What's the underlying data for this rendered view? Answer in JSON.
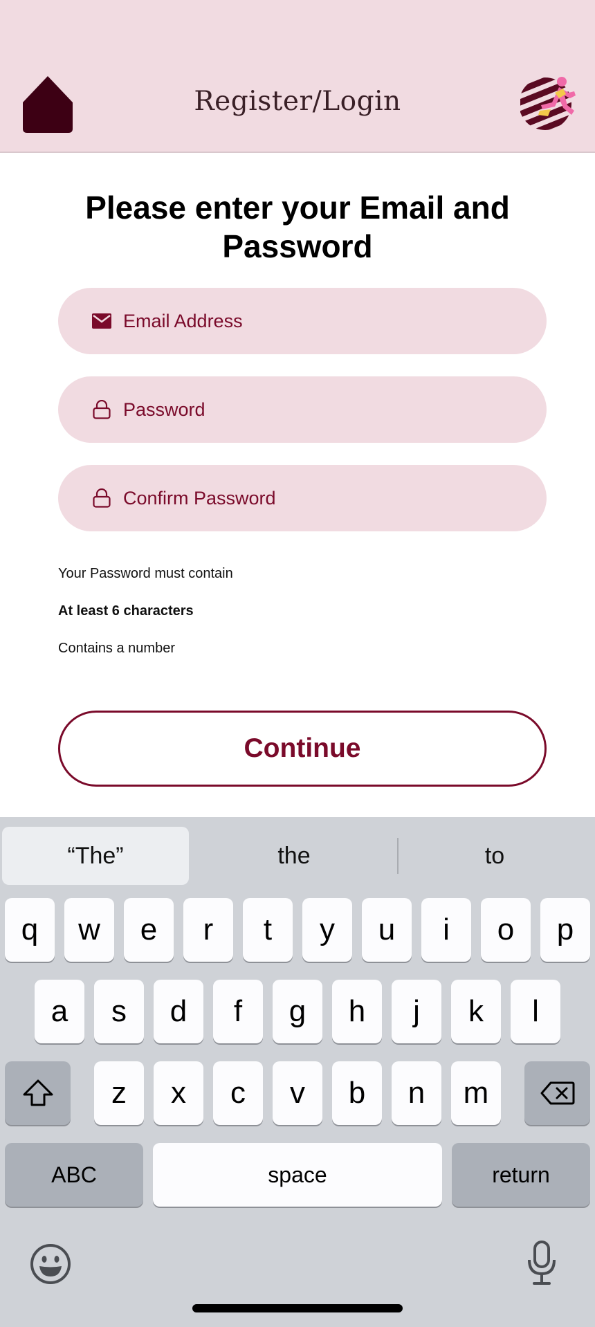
{
  "header": {
    "title": "Register/Login",
    "home_icon": "home-icon",
    "logo_icon": "runner-logo"
  },
  "main": {
    "heading": "Please enter your Email and Password",
    "email": {
      "placeholder": "Email Address",
      "value": "",
      "icon": "mail-icon"
    },
    "password": {
      "placeholder": "Password",
      "value": "",
      "icon": "lock-icon"
    },
    "confirm": {
      "placeholder": "Confirm Password",
      "value": "",
      "icon": "lock-icon"
    },
    "rules": {
      "intro": "Your Password must contain",
      "rule1": "At least 6 characters",
      "rule2": "Contains a number"
    },
    "continue_label": "Continue"
  },
  "keyboard": {
    "suggestions": [
      "“The”",
      "the",
      "to"
    ],
    "row1": [
      "q",
      "w",
      "e",
      "r",
      "t",
      "y",
      "u",
      "i",
      "o",
      "p"
    ],
    "row2": [
      "a",
      "s",
      "d",
      "f",
      "g",
      "h",
      "j",
      "k",
      "l"
    ],
    "row3": [
      "z",
      "x",
      "c",
      "v",
      "b",
      "n",
      "m"
    ],
    "abc_label": "ABC",
    "space_label": "space",
    "return_label": "return"
  },
  "colors": {
    "brand": "#7a0a2a",
    "header_bg": "#f1dbe1",
    "field_bg": "#f1dbe1",
    "keyboard_bg": "#cfd2d7"
  }
}
